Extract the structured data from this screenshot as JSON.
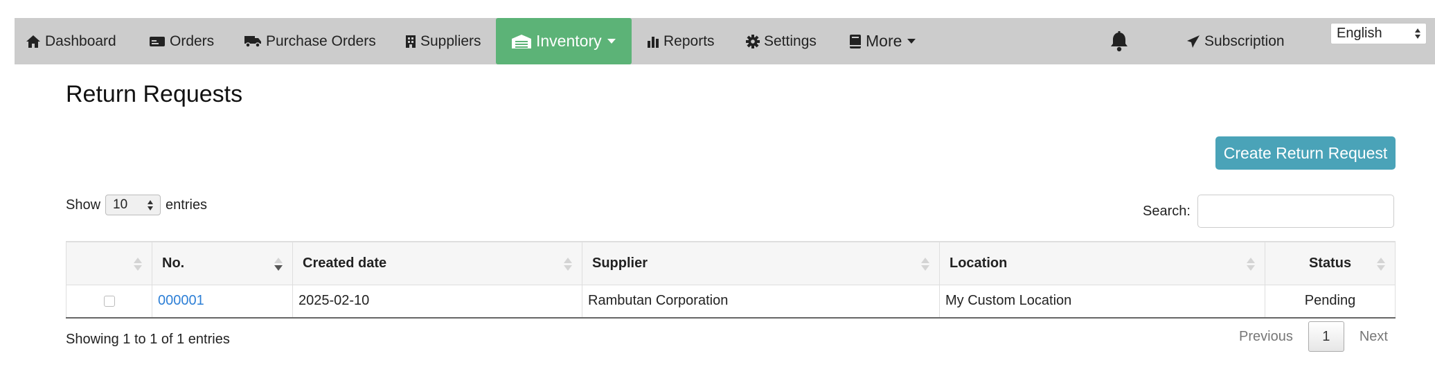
{
  "nav": {
    "items": [
      {
        "label": "Dashboard",
        "icon": "home-icon"
      },
      {
        "label": "Orders",
        "icon": "credit-card-icon"
      },
      {
        "label": "Purchase Orders",
        "icon": "truck-icon"
      },
      {
        "label": "Suppliers",
        "icon": "building-icon"
      },
      {
        "label": "Inventory",
        "icon": "warehouse-icon",
        "active": true
      },
      {
        "label": "Reports",
        "icon": "bar-chart-icon"
      },
      {
        "label": "Settings",
        "icon": "gear-icon"
      },
      {
        "label": "More",
        "icon": "book-icon"
      }
    ],
    "subscription": "Subscription",
    "language": "English",
    "active_color": "#5cb377"
  },
  "page": {
    "title": "Return Requests",
    "create_button": "Create Return Request",
    "show_label": "Show",
    "entries_label": "entries",
    "page_length": "10",
    "search_label": "Search:",
    "search_value": ""
  },
  "table": {
    "columns": [
      "",
      "No.",
      "Created date",
      "Supplier",
      "Location",
      "Status"
    ],
    "rows": [
      {
        "no": "000001",
        "created_date": "2025-02-10",
        "supplier": "Rambutan Corporation",
        "location": "My Custom Location",
        "status": "Pending"
      }
    ]
  },
  "footer": {
    "info": "Showing 1 to 1 of 1 entries",
    "previous": "Previous",
    "current_page": "1",
    "next": "Next"
  }
}
